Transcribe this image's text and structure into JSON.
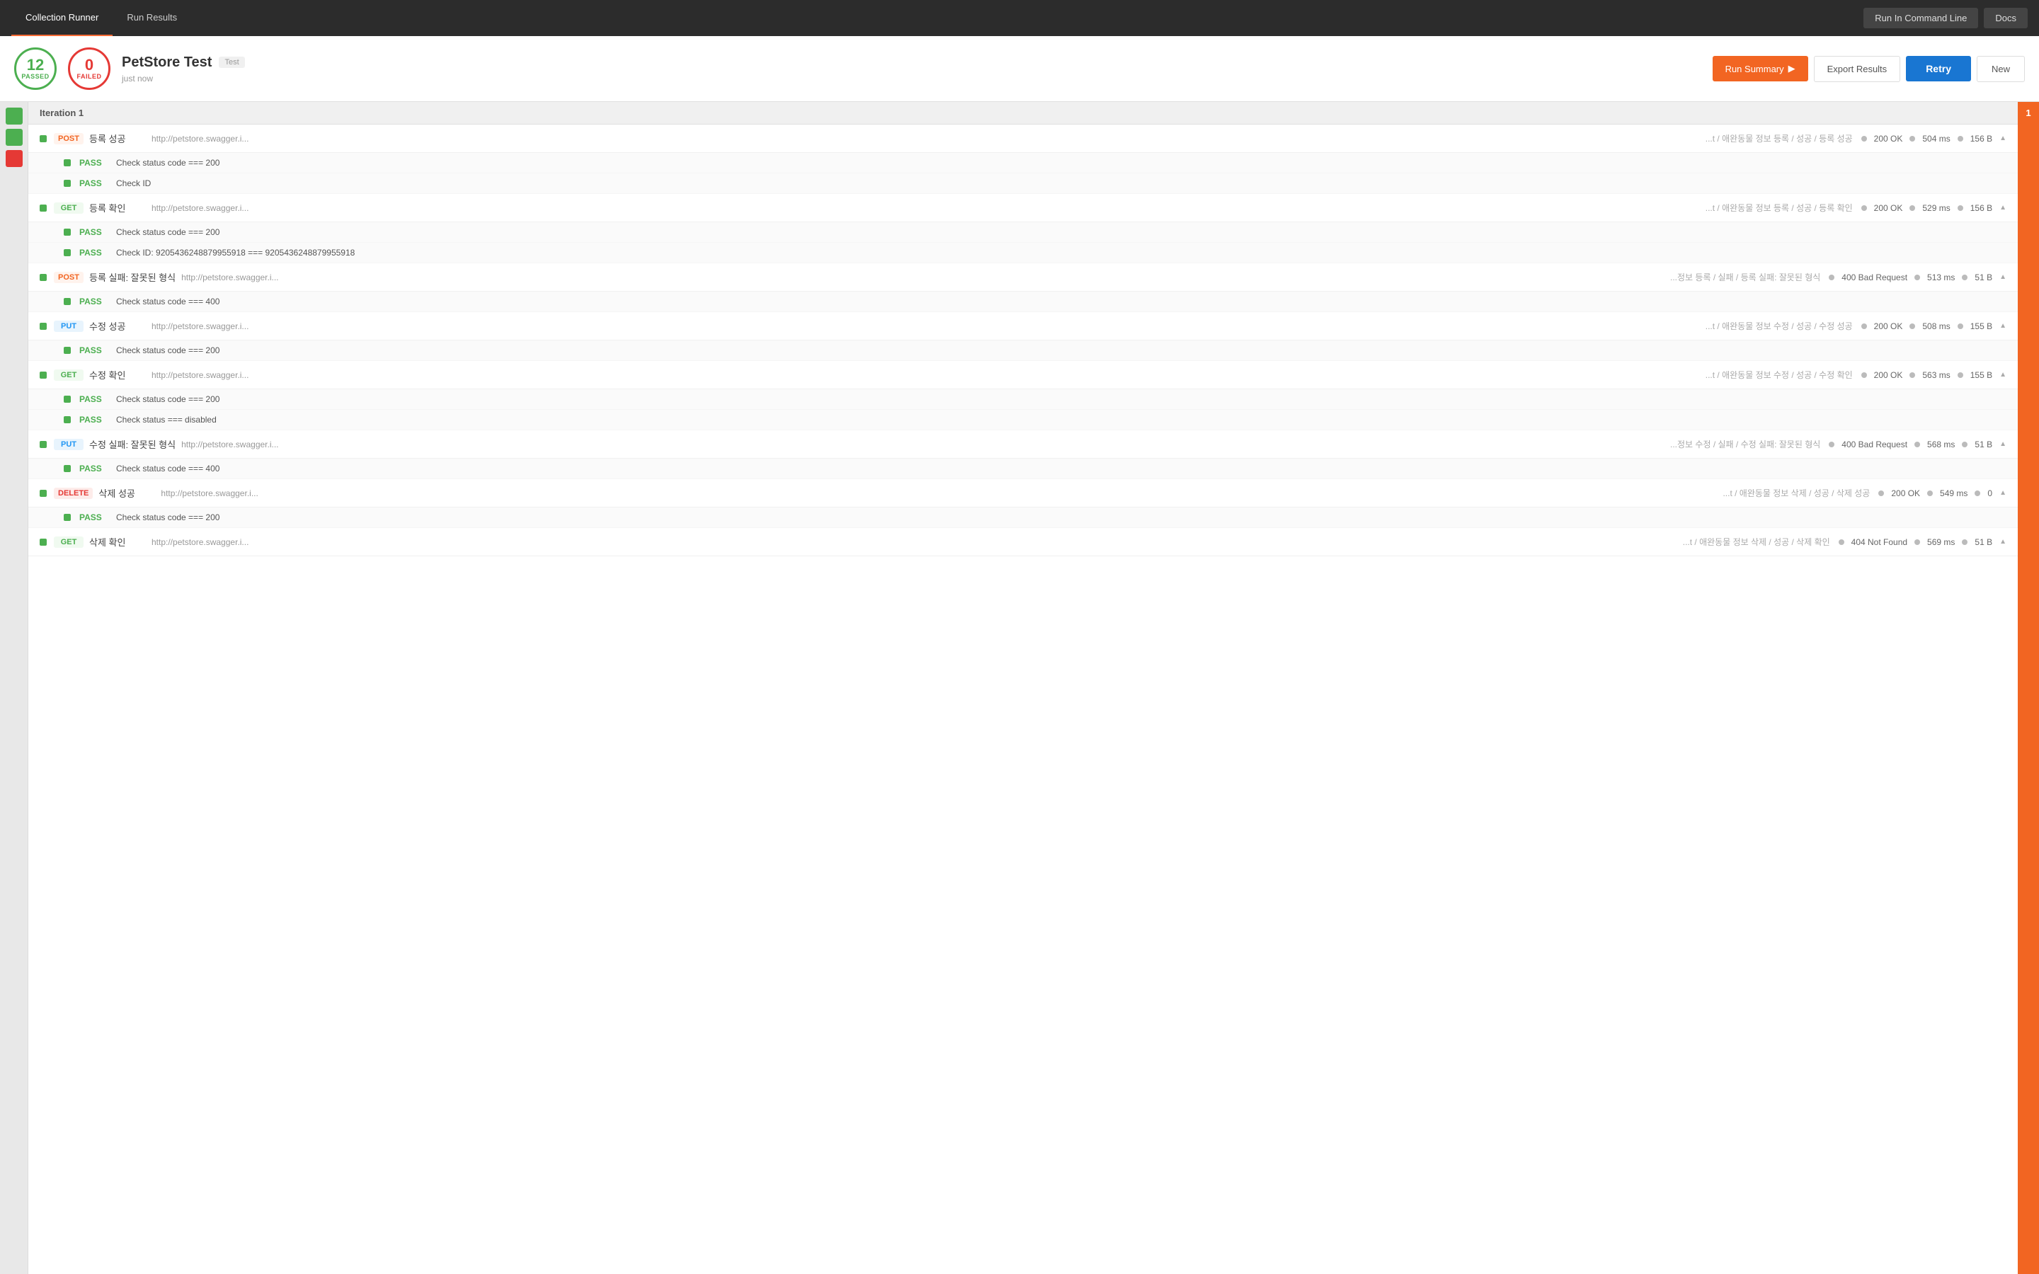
{
  "header": {
    "tabs": [
      {
        "id": "collection-runner",
        "label": "Collection Runner",
        "active": true
      },
      {
        "id": "run-results",
        "label": "Run Results",
        "active": false
      }
    ],
    "run_in_command_line": "Run In Command Line",
    "docs": "Docs"
  },
  "subheader": {
    "passed": {
      "number": "12",
      "label": "PASSED"
    },
    "failed": {
      "number": "0",
      "label": "FAILED"
    },
    "title": "PetStore Test",
    "tag": "Test",
    "time": "just now",
    "run_summary_label": "Run Summary",
    "export_results_label": "Export Results",
    "retry_label": "Retry",
    "new_label": "New"
  },
  "iteration": {
    "label": "Iteration 1"
  },
  "requests": [
    {
      "id": "req1",
      "method": "POST",
      "method_class": "method-post",
      "name": "등록 성공",
      "url": "http://petstore.swagger.i...",
      "breadcrumb": "...t / 애완동물 정보 등록 / 성공 / 등록 성공",
      "status": "200 OK",
      "time": "504 ms",
      "size": "156 B",
      "tests": [
        {
          "label": "PASS",
          "name": "Check status code === 200"
        },
        {
          "label": "PASS",
          "name": "Check ID"
        }
      ]
    },
    {
      "id": "req2",
      "method": "GET",
      "method_class": "method-get",
      "name": "등록 확인",
      "url": "http://petstore.swagger.i...",
      "breadcrumb": "...t / 애완동물 정보 등록 / 성공 / 등록 확인",
      "status": "200 OK",
      "time": "529 ms",
      "size": "156 B",
      "tests": [
        {
          "label": "PASS",
          "name": "Check status code === 200"
        },
        {
          "label": "PASS",
          "name": "Check ID: 9205436248879955918 === 9205436248879955918"
        }
      ]
    },
    {
      "id": "req3",
      "method": "POST",
      "method_class": "method-post",
      "name": "등록 실패: 잘못된 형식",
      "url": "http://petstore.swagger.i...",
      "breadcrumb": "...정보 등록 / 실패 / 등록 실패: 잘못된 형식",
      "status": "400 Bad Request",
      "time": "513 ms",
      "size": "51 B",
      "tests": [
        {
          "label": "PASS",
          "name": "Check status code === 400"
        }
      ]
    },
    {
      "id": "req4",
      "method": "PUT",
      "method_class": "method-put",
      "name": "수정 성공",
      "url": "http://petstore.swagger.i...",
      "breadcrumb": "...t / 애완동물 정보 수정 / 성공 / 수정 성공",
      "status": "200 OK",
      "time": "508 ms",
      "size": "155 B",
      "tests": [
        {
          "label": "PASS",
          "name": "Check status code === 200"
        }
      ]
    },
    {
      "id": "req5",
      "method": "GET",
      "method_class": "method-get",
      "name": "수정 확인",
      "url": "http://petstore.swagger.i...",
      "breadcrumb": "...t / 애완동물 정보 수정 / 성공 / 수정 확인",
      "status": "200 OK",
      "time": "563 ms",
      "size": "155 B",
      "tests": [
        {
          "label": "PASS",
          "name": "Check status code === 200"
        },
        {
          "label": "PASS",
          "name": "Check status === disabled"
        }
      ]
    },
    {
      "id": "req6",
      "method": "PUT",
      "method_class": "method-put",
      "name": "수정 실패: 잘못된 형식",
      "url": "http://petstore.swagger.i...",
      "breadcrumb": "...정보 수정 / 실패 / 수정 실패: 잘못된 형식",
      "status": "400 Bad Request",
      "time": "568 ms",
      "size": "51 B",
      "tests": [
        {
          "label": "PASS",
          "name": "Check status code === 400"
        }
      ]
    },
    {
      "id": "req7",
      "method": "DELETE",
      "method_class": "method-delete",
      "name": "삭제 성공",
      "url": "http://petstore.swagger.i...",
      "breadcrumb": "...t / 애완동물 정보 삭제 / 성공 / 삭제 성공",
      "status": "200 OK",
      "time": "549 ms",
      "size": "0",
      "tests": [
        {
          "label": "PASS",
          "name": "Check status code === 200"
        }
      ]
    },
    {
      "id": "req8",
      "method": "GET",
      "method_class": "method-get",
      "name": "삭제 확인",
      "url": "http://petstore.swagger.i...",
      "breadcrumb": "...t / 애완동물 정보 삭제 / 성공 / 삭제 확인",
      "status": "404 Not Found",
      "time": "569 ms",
      "size": "51 B",
      "tests": []
    }
  ],
  "right_sidebar": {
    "number": "1"
  },
  "sidebar_icons": [
    {
      "color": "green"
    },
    {
      "color": "green"
    },
    {
      "color": "red"
    }
  ]
}
